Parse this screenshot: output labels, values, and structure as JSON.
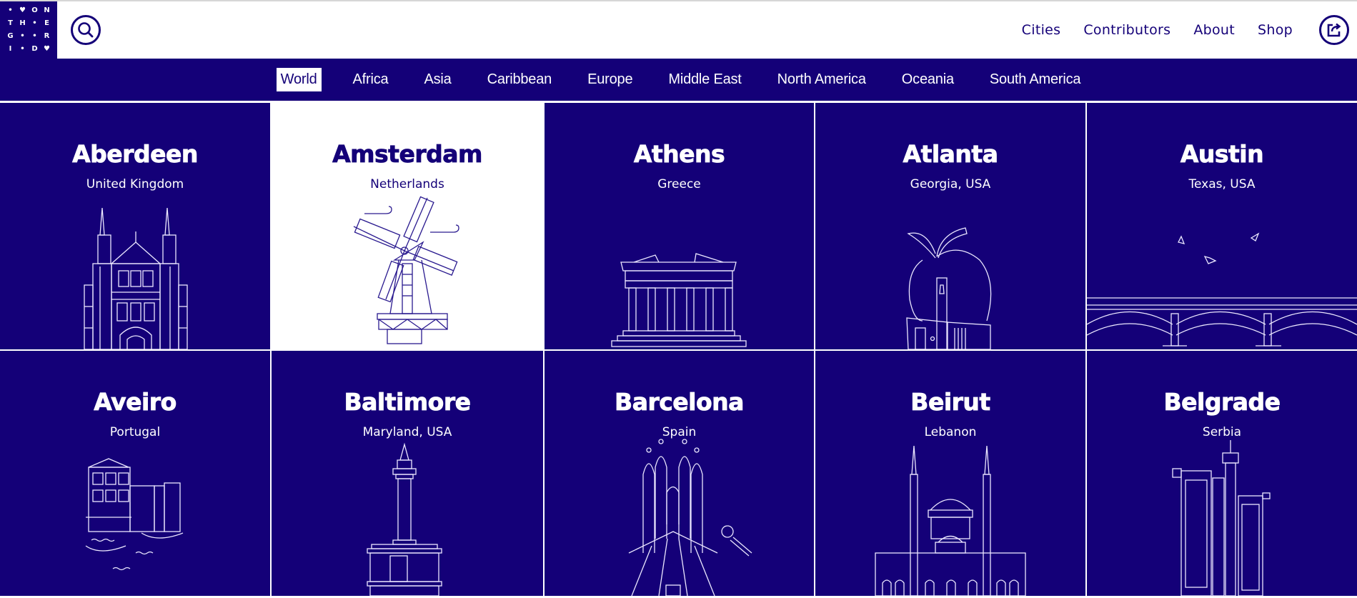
{
  "header": {
    "logo": {
      "cells": [
        "•",
        "♥",
        "O",
        "N",
        "T",
        "H",
        "•",
        "E",
        "G",
        "•",
        "•",
        "R",
        "I",
        "•",
        "D",
        "♥"
      ],
      "label": "On The Grid"
    },
    "search_icon": "search-icon",
    "nav": [
      {
        "label": "Cities"
      },
      {
        "label": "Contributors"
      },
      {
        "label": "About"
      },
      {
        "label": "Shop"
      }
    ],
    "share_icon": "share-icon"
  },
  "regions": {
    "active": "World",
    "tabs": [
      {
        "label": "World"
      },
      {
        "label": "Africa"
      },
      {
        "label": "Asia"
      },
      {
        "label": "Caribbean"
      },
      {
        "label": "Europe"
      },
      {
        "label": "Middle East"
      },
      {
        "label": "North America"
      },
      {
        "label": "Oceania"
      },
      {
        "label": "South America"
      }
    ]
  },
  "cities": [
    {
      "name": "Aberdeen",
      "country": "United Kingdom",
      "illustration": "granite-gothic-college"
    },
    {
      "name": "Amsterdam",
      "country": "Netherlands",
      "illustration": "windmill",
      "hovered": true
    },
    {
      "name": "Athens",
      "country": "Greece",
      "illustration": "parthenon"
    },
    {
      "name": "Atlanta",
      "country": "Georgia, USA",
      "illustration": "apple-and-coca-cola-building"
    },
    {
      "name": "Austin",
      "country": "Texas, USA",
      "illustration": "bridge-with-bats"
    },
    {
      "name": "Aveiro",
      "country": "Portugal",
      "illustration": "canal-houses-and-boats"
    },
    {
      "name": "Baltimore",
      "country": "Maryland, USA",
      "illustration": "washington-monument"
    },
    {
      "name": "Barcelona",
      "country": "Spain",
      "illustration": "sagrada-familia-and-football"
    },
    {
      "name": "Beirut",
      "country": "Lebanon",
      "illustration": "mosque-with-minarets"
    },
    {
      "name": "Belgrade",
      "country": "Serbia",
      "illustration": "towers-and-skyscrapers"
    }
  ],
  "colors": {
    "brand_navy": "#140078",
    "white": "#ffffff",
    "divider": "#ffffff"
  }
}
